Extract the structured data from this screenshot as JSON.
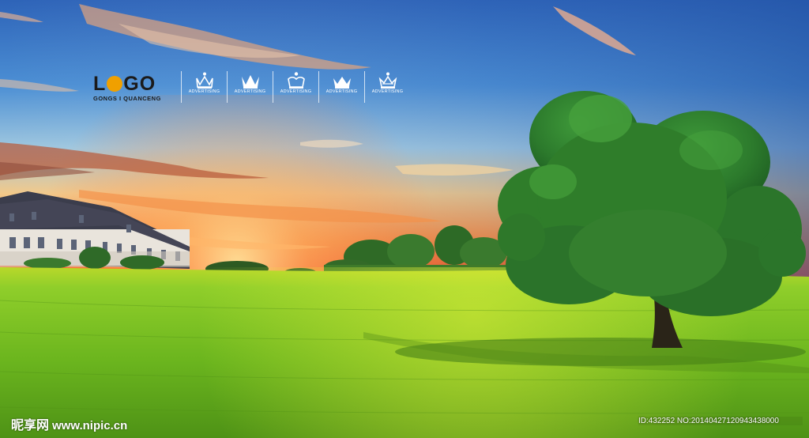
{
  "logo": {
    "main_prefix": "L",
    "main_suffix": "GO",
    "subtitle": "GONGS I QUANCENG"
  },
  "crowns": [
    {
      "icon": "crown-icon",
      "caption": "ADVERTISING"
    },
    {
      "icon": "crown-icon",
      "caption": "ADVERTISING"
    },
    {
      "icon": "crown-icon",
      "caption": "ADVERTISING"
    },
    {
      "icon": "crown-icon",
      "caption": "ADVERTISING"
    },
    {
      "icon": "crown-icon",
      "caption": "ADVERTISING"
    }
  ],
  "watermark": {
    "brand": "昵享网",
    "site": "www.nipic.cn",
    "id_text": "ID:432252 NO:20140427120943438000"
  },
  "colors": {
    "sky_top": "#2a66bf",
    "sunset": "#ff5a1e",
    "grass": "#7cc21e",
    "tree": "#2f7d2a",
    "logo_accent": "#f0a000"
  }
}
